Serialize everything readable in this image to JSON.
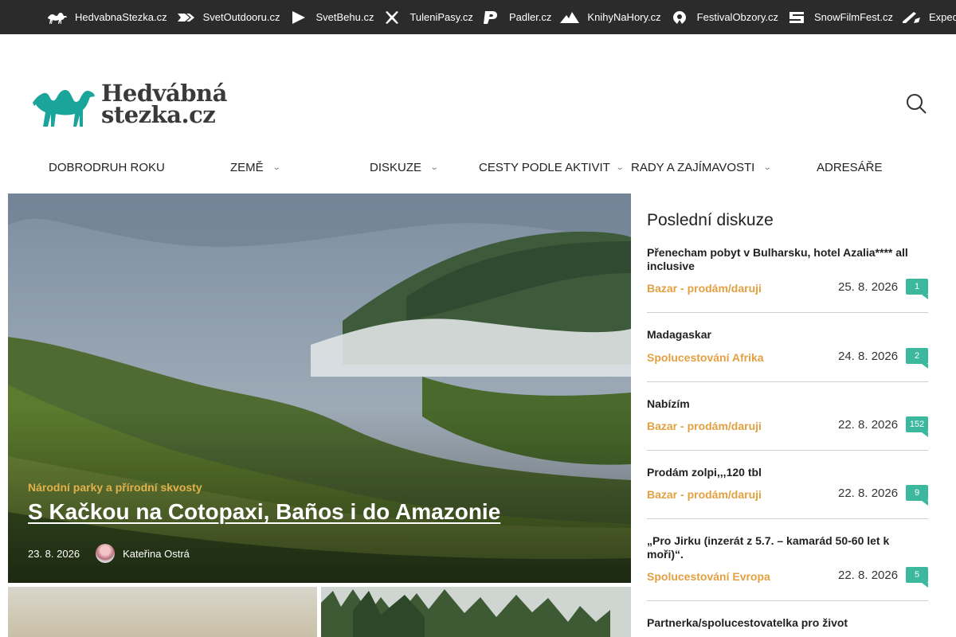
{
  "network": [
    {
      "label": "HedvabnaStezka.cz",
      "icon": "camel-icon"
    },
    {
      "label": "SvetOutdooru.cz",
      "icon": "arrow-icon"
    },
    {
      "label": "SvetBehu.cz",
      "icon": "play-icon"
    },
    {
      "label": "TuleniPasy.cz",
      "icon": "cross-icon"
    },
    {
      "label": "Padler.cz",
      "icon": "p-icon"
    },
    {
      "label": "KnihyNaHory.cz",
      "icon": "mountain-icon"
    },
    {
      "label": "FestivalObzory.cz",
      "icon": "festival-icon"
    },
    {
      "label": "SnowFilmFest.cz",
      "icon": "s-icon"
    },
    {
      "label": "ExpedicniKamera.cz",
      "icon": "camera-icon"
    }
  ],
  "logo": {
    "line1": "Hedvábná",
    "line2": "stezka.cz",
    "color": "#1aa59a"
  },
  "nav": [
    {
      "label": "Dobrodruh roku",
      "dropdown": false
    },
    {
      "label": "Země",
      "dropdown": true
    },
    {
      "label": "Diskuze",
      "dropdown": true
    },
    {
      "label": "Cesty podle aktivit",
      "dropdown": true
    },
    {
      "label": "Rady a zajímavosti",
      "dropdown": true
    },
    {
      "label": "Adresáře",
      "dropdown": false
    }
  ],
  "hero": {
    "category": "Národní parky a přírodní skvosty",
    "title": "S Kačkou na Cotopaxi, Baños i do Amazonie",
    "date": "23. 8. 2026",
    "author": "Kateřina Ostrá"
  },
  "sidebar": {
    "title": "Poslední diskuze",
    "items": [
      {
        "title": "Přenecham pobyt v Bulharsku, hotel Azalia**** all inclusive",
        "category": "Bazar - prodám/daruji",
        "date": "25. 8. 2026",
        "count": "1"
      },
      {
        "title": "Madagaskar",
        "category": "Spolucestování Afrika",
        "date": "24. 8. 2026",
        "count": "2"
      },
      {
        "title": "Nabízím",
        "category": "Bazar - prodám/daruji",
        "date": "22. 8. 2026",
        "count": "152"
      },
      {
        "title": "Prodám zolpi,,,120 tbl",
        "category": "Bazar - prodám/daruji",
        "date": "22. 8. 2026",
        "count": "9"
      },
      {
        "title": "„Pro Jirku (inzerát z 5.7. – kamarád 50-60 let k moři)“.",
        "category": "Spolucestování Evropa",
        "date": "22. 8. 2026",
        "count": "5"
      },
      {
        "title": "Partnerka/spolucestovatelka pro život",
        "category": "",
        "date": "",
        "count": ""
      }
    ]
  },
  "colors": {
    "accent": "#1aa59a",
    "category": "#e3a040",
    "badge": "#3cb89f",
    "topbar": "#2b2b2b"
  }
}
